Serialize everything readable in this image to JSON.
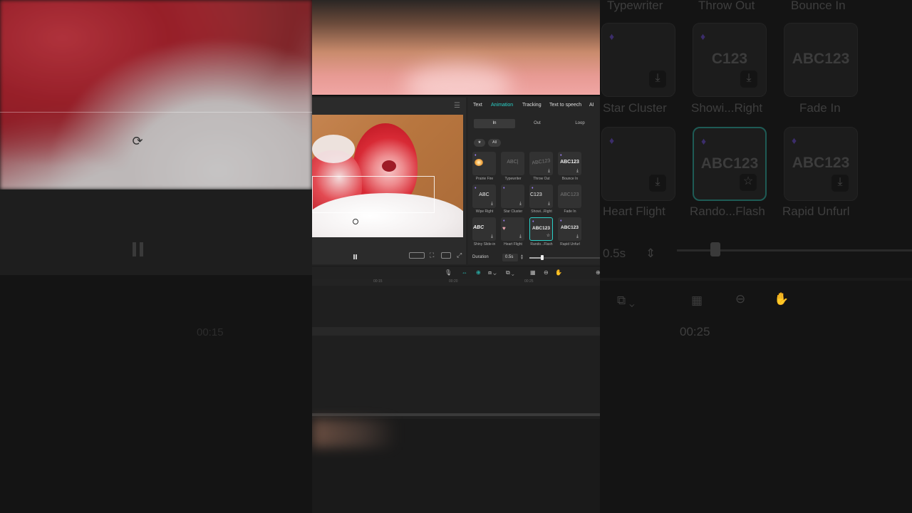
{
  "tabs": [
    "Text",
    "Animation",
    "Tracking",
    "Text to speech",
    "AI"
  ],
  "active_tab": "Animation",
  "subtabs": [
    "In",
    "Out",
    "Loop"
  ],
  "filters": {
    "favorite_icon": "star-icon",
    "all": "All"
  },
  "items": [
    {
      "label": "Prairie Fire",
      "thumb": "",
      "premium": true,
      "download": false
    },
    {
      "label": "Typewriter",
      "thumb": "ABC|",
      "premium": false,
      "download": false
    },
    {
      "label": "Throw Out",
      "thumb": "ABC123",
      "premium": false,
      "download": true
    },
    {
      "label": "Bounce In",
      "thumb": "ABC123",
      "premium": true,
      "download": true
    },
    {
      "label": "Wipe Right",
      "thumb": "ABC",
      "premium": true,
      "download": true
    },
    {
      "label": "Star Cluster",
      "thumb": "",
      "premium": true,
      "download": true
    },
    {
      "label": "Showi...Right",
      "thumb": "C123",
      "premium": true,
      "download": true
    },
    {
      "label": "Fade In",
      "thumb": "ABC123",
      "premium": false,
      "download": false
    },
    {
      "label": "Shiny Slide-in",
      "thumb": "ABC",
      "premium": false,
      "download": true
    },
    {
      "label": "Heart Flight",
      "thumb": "",
      "premium": true,
      "download": true
    },
    {
      "label": "Rando...Flash",
      "thumb": "ABC123",
      "premium": true,
      "download": false,
      "selected": true
    },
    {
      "label": "Rapid Unfurl",
      "thumb": "ABC123",
      "premium": true,
      "download": true
    }
  ],
  "duration": {
    "label": "Duration",
    "value": "0.5s",
    "slider_fraction": 0.18
  },
  "timeline": {
    "ticks": [
      "00:15",
      "00:20",
      "00:25"
    ]
  },
  "background": {
    "left_time": "00:15",
    "right_labels_top": [
      "Typewriter",
      "Throw Out",
      "Bounce In"
    ],
    "right_labels_mid": [
      "Star Cluster",
      "Showi...Right",
      "Fade In"
    ],
    "right_labels_bot": [
      "Heart Flight",
      "Rando...Flash",
      "Rapid Unfurl"
    ],
    "right_card_text": "ABC123",
    "right_card_text_cut": "C123",
    "right_duration": "0.5s",
    "right_time": "00:25"
  },
  "colors": {
    "accent": "#2ad1c8",
    "premium": "#9a7cf0"
  }
}
